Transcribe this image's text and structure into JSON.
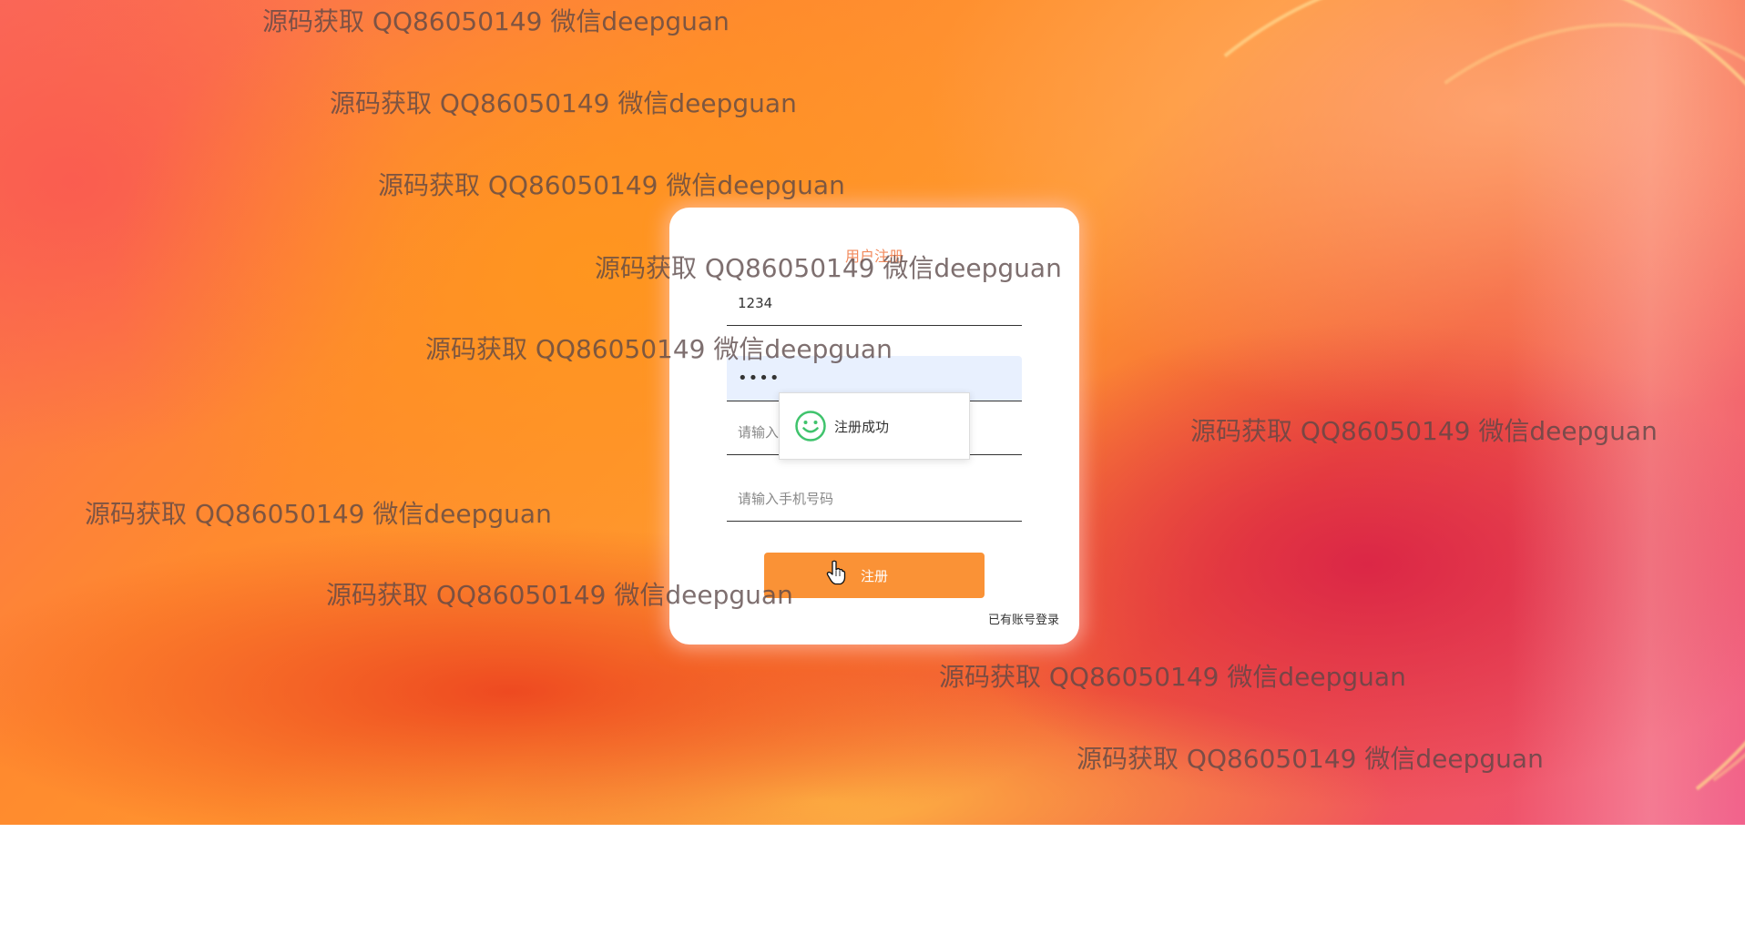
{
  "form": {
    "title": "用户注册",
    "username_value": "1234",
    "password_value": "1234",
    "name_placeholder": "请输入用户姓名",
    "phone_placeholder": "请输入手机号码",
    "submit_label": "注册",
    "login_link": "已有账号登录"
  },
  "toast": {
    "message": "注册成功",
    "icon": "smile-icon"
  },
  "watermark": {
    "text": "源码获取 QQ86050149 微信deepguan"
  },
  "colors": {
    "accent": "#fa9236",
    "title": "#f28a5c",
    "success": "#3fc36c",
    "autofill": "#e8f0fe"
  }
}
